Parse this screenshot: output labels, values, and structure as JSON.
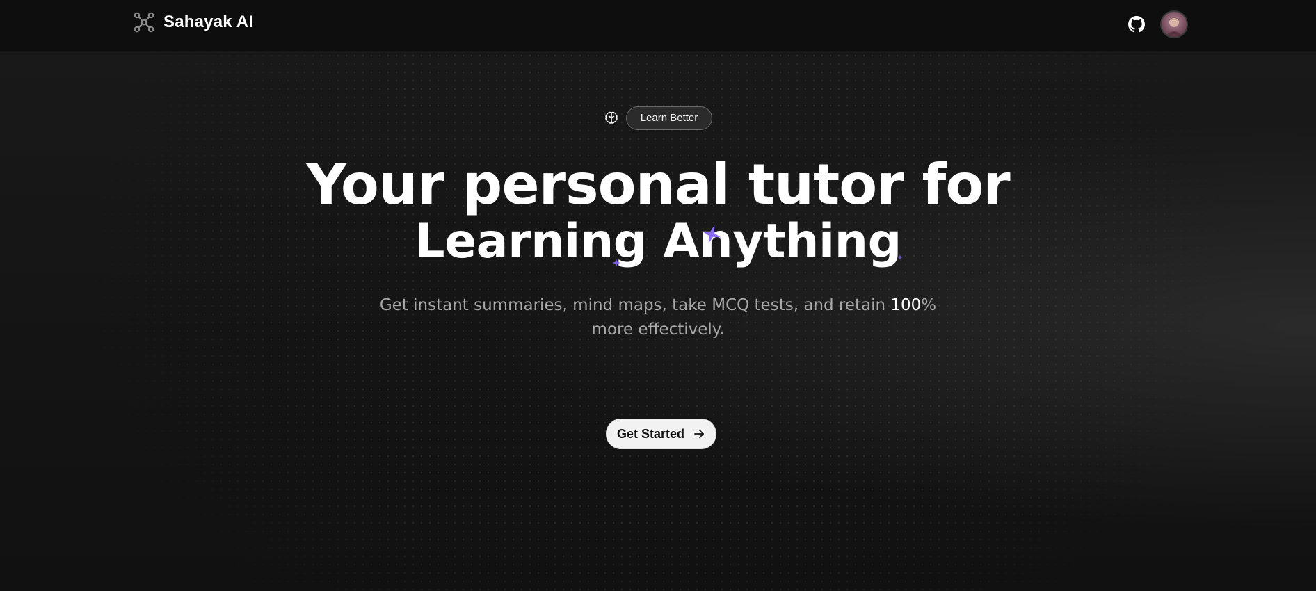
{
  "navbar": {
    "brand_name": "Sahayak AI",
    "brand_icon": "network-nodes-icon",
    "github_icon": "github-icon",
    "avatar_icon": "user-avatar"
  },
  "hero": {
    "badge_icon": "brain-icon",
    "badge_label": "Learn Better",
    "headline_line1": "Your personal tutor for",
    "headline_line2": "Learning Anything",
    "subtitle_part1": "Get instant summaries, mind maps, take MCQ tests, and retain ",
    "subtitle_highlight": "100",
    "subtitle_part2": "% more effectively.",
    "cta_label": "Get Started",
    "cta_icon": "arrow-right-icon"
  },
  "colors": {
    "background": "#121212",
    "navbar": "#0e0e0e",
    "accent_sparkle": "#8b6cf0",
    "text_primary": "#ffffff",
    "text_secondary": "#a8a8a8",
    "cta_background": "#f2f2f2"
  }
}
